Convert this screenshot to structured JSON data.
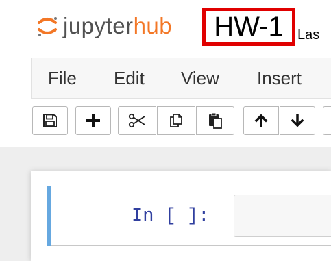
{
  "header": {
    "logo": {
      "part1": "jupyter",
      "part2": "hub"
    },
    "notebook_title": "HW-1",
    "last_saved_fragment": "Las"
  },
  "menubar": {
    "items": [
      {
        "label": "File"
      },
      {
        "label": "Edit"
      },
      {
        "label": "View"
      },
      {
        "label": "Insert"
      }
    ]
  },
  "toolbar": {
    "buttons": [
      {
        "icon": "save-icon"
      },
      {
        "icon": "plus-icon"
      },
      {
        "icon": "scissors-icon"
      },
      {
        "icon": "copy-icon"
      },
      {
        "icon": "paste-icon"
      },
      {
        "icon": "arrow-up-icon"
      },
      {
        "icon": "arrow-down-icon"
      }
    ]
  },
  "cell": {
    "prompt": "In [ ]:",
    "input_value": ""
  },
  "colors": {
    "logo_orange": "#F37726",
    "logo_gray": "#515151",
    "title_highlight": "#e00000",
    "prompt_blue": "#303F9F",
    "cell_marker": "#66a8e0"
  }
}
